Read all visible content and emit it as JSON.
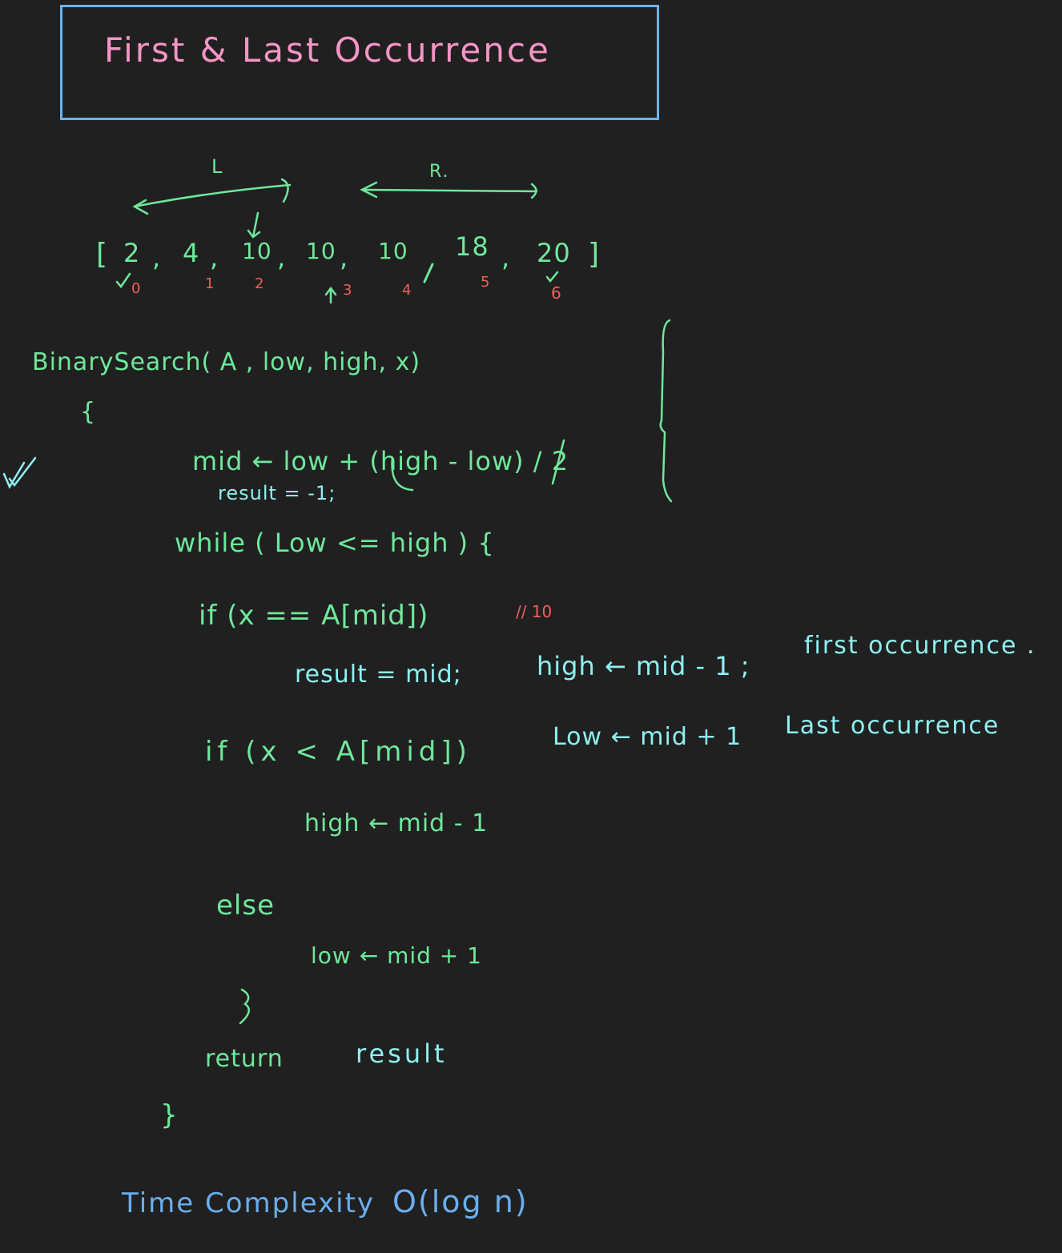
{
  "title": "First & Last Occurrence",
  "colors": {
    "background": "#212020",
    "title_box": "#6ab4ee",
    "title_text": "#f595c6",
    "code": "#6ee89c",
    "annotation": "#8ef0f0",
    "index": "#f0605a",
    "complexity": "#6aaef0"
  },
  "diagram": {
    "left_label": "L",
    "right_label": "R.",
    "array": {
      "open": "[",
      "values": [
        "2",
        "4",
        "10",
        "10",
        "10",
        "18",
        "20"
      ],
      "close": "]",
      "indices": [
        "0",
        "1",
        "2",
        "3",
        "4",
        "5",
        "6"
      ]
    }
  },
  "code": {
    "signature": "BinarySearch( A , low, high, x)",
    "open_brace": "{",
    "mid_line": "mid ← low + (high - low) / 2",
    "result_init": "result = -1;",
    "while_line": "while ( Low <= high ) {",
    "if_equal": "if (x == A[mid])",
    "if_equal_comment": "// 10",
    "equal_body": "result = mid;",
    "first_occ_stmt": "high ← mid - 1 ;",
    "first_occ_label": "first occurrence .",
    "if_less": "if (x < A[mid])",
    "last_occ_stmt": "Low ← mid + 1",
    "last_occ_label": "Last occurrence",
    "less_body": "high ← mid - 1",
    "else_label": "else",
    "else_body": "low ← mid + 1",
    "close_while": "}",
    "return_kw": "return",
    "return_val": "result",
    "close_fn": "}"
  },
  "complexity": {
    "label": "Time Complexity",
    "value": "O(log n)"
  }
}
